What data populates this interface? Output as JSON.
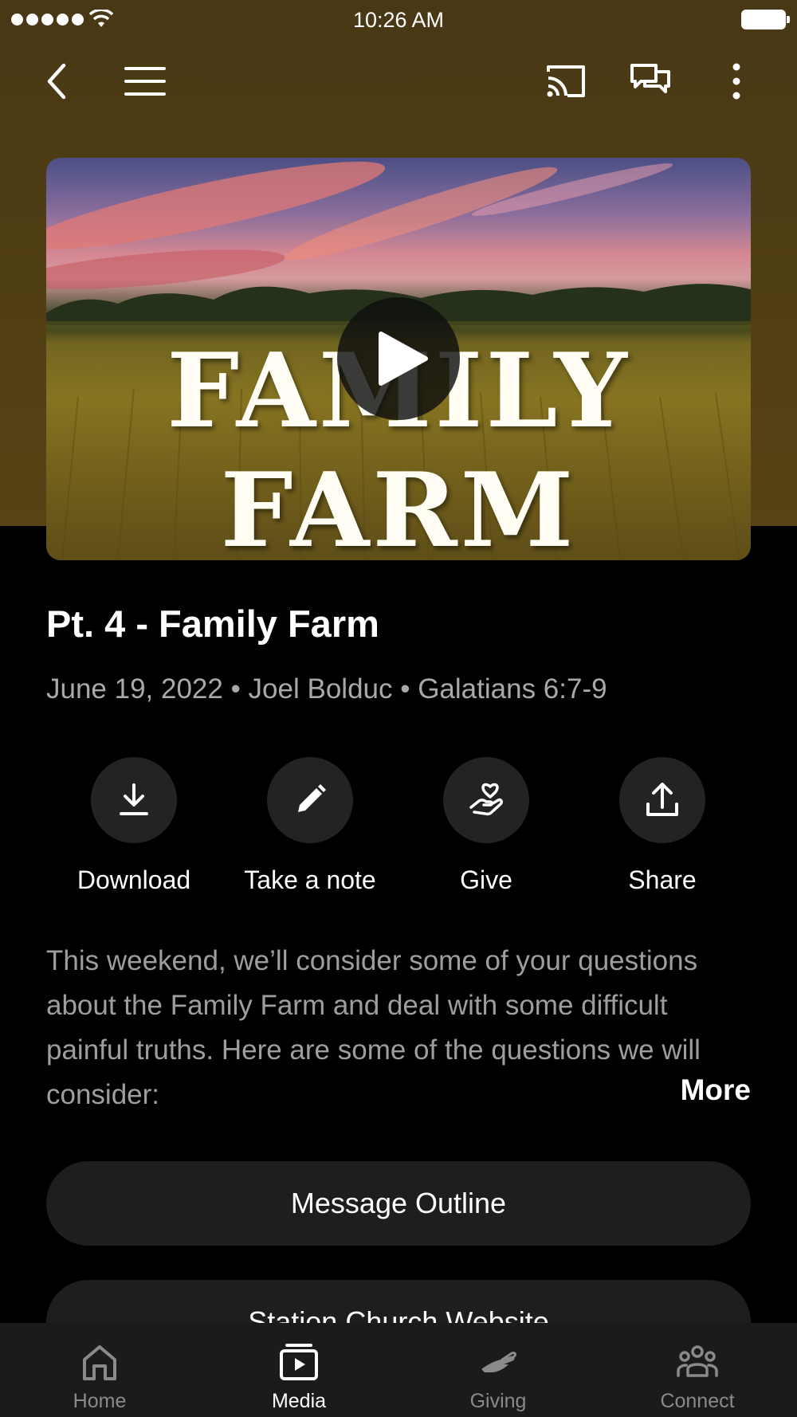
{
  "status_bar": {
    "time": "10:26 AM"
  },
  "header": {
    "icons": [
      "back-arrow-icon",
      "menu-icon",
      "cast-icon",
      "chat-icon",
      "more-vertical-icon"
    ]
  },
  "video": {
    "artwork_text": "FAMILY FARM",
    "play_icon": "play-icon"
  },
  "sermon": {
    "title": "Pt. 4 - Family Farm",
    "meta": "June 19, 2022 • Joel Bolduc • Galatians 6:7-9",
    "description": "This weekend, we’ll consider some of your questions about the Family Farm and deal with some difficult painful truths.  Here are some of the questions we will consider:",
    "more_label": "More"
  },
  "actions": [
    {
      "label": "Download",
      "icon": "download-icon"
    },
    {
      "label": "Take a note",
      "icon": "pencil-icon"
    },
    {
      "label": "Give",
      "icon": "give-heart-hand-icon"
    },
    {
      "label": "Share",
      "icon": "share-icon"
    }
  ],
  "buttons": {
    "outline": "Message Outline",
    "website": "Station Church Website"
  },
  "tab_bar": {
    "active": "Media",
    "tabs": [
      {
        "label": "Home",
        "icon": "home-icon"
      },
      {
        "label": "Media",
        "icon": "media-icon"
      },
      {
        "label": "Giving",
        "icon": "giving-icon"
      },
      {
        "label": "Connect",
        "icon": "connect-icon"
      }
    ]
  },
  "colors": {
    "hero_background": "#4f3d14",
    "page_background": "#000000",
    "secondary_text": "#a9a9a9",
    "button_background": "#1e1e1e",
    "tab_bar_background": "#1b1b1b"
  }
}
